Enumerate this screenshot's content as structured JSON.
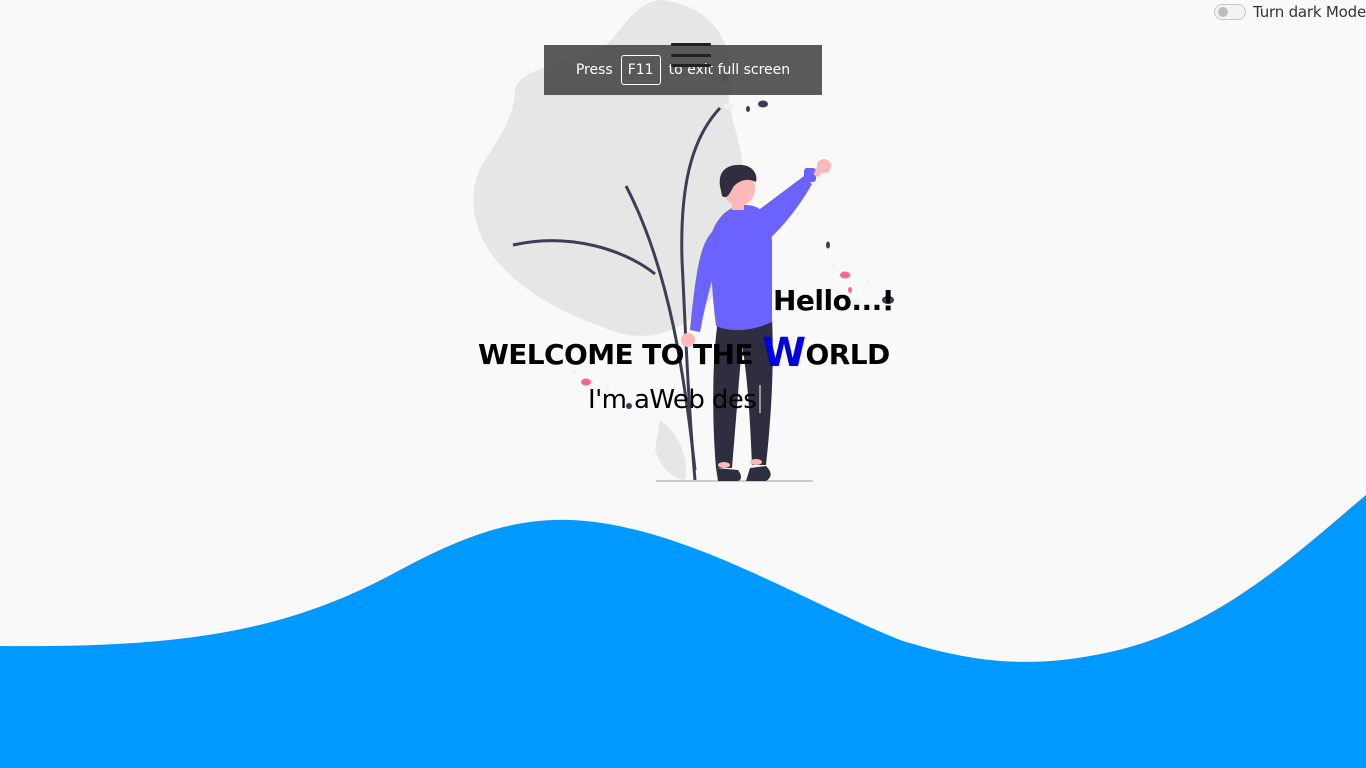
{
  "dark_mode_toggle": {
    "label": "Turn dark Mode"
  },
  "fullscreen_notice": {
    "prefix": "Press",
    "key": "F11",
    "suffix": "to exit full screen"
  },
  "hero": {
    "greeting": "Hello...!",
    "welcome_prefix": "WELCOME TO THE ",
    "welcome_highlight": "W",
    "welcome_suffix": "ORLD",
    "typed_prefix": "I'm a",
    "typed_text": "Web des"
  },
  "colors": {
    "background": "#f9f9f9",
    "wave": "#0099ff",
    "highlight": "#0000e0",
    "person_shirt": "#6c63ff",
    "person_pants": "#2f2e41",
    "skin": "#ffb8b8",
    "leaf": "#e6e6e6"
  },
  "icons": {
    "menu": "hamburger-menu-icon"
  }
}
